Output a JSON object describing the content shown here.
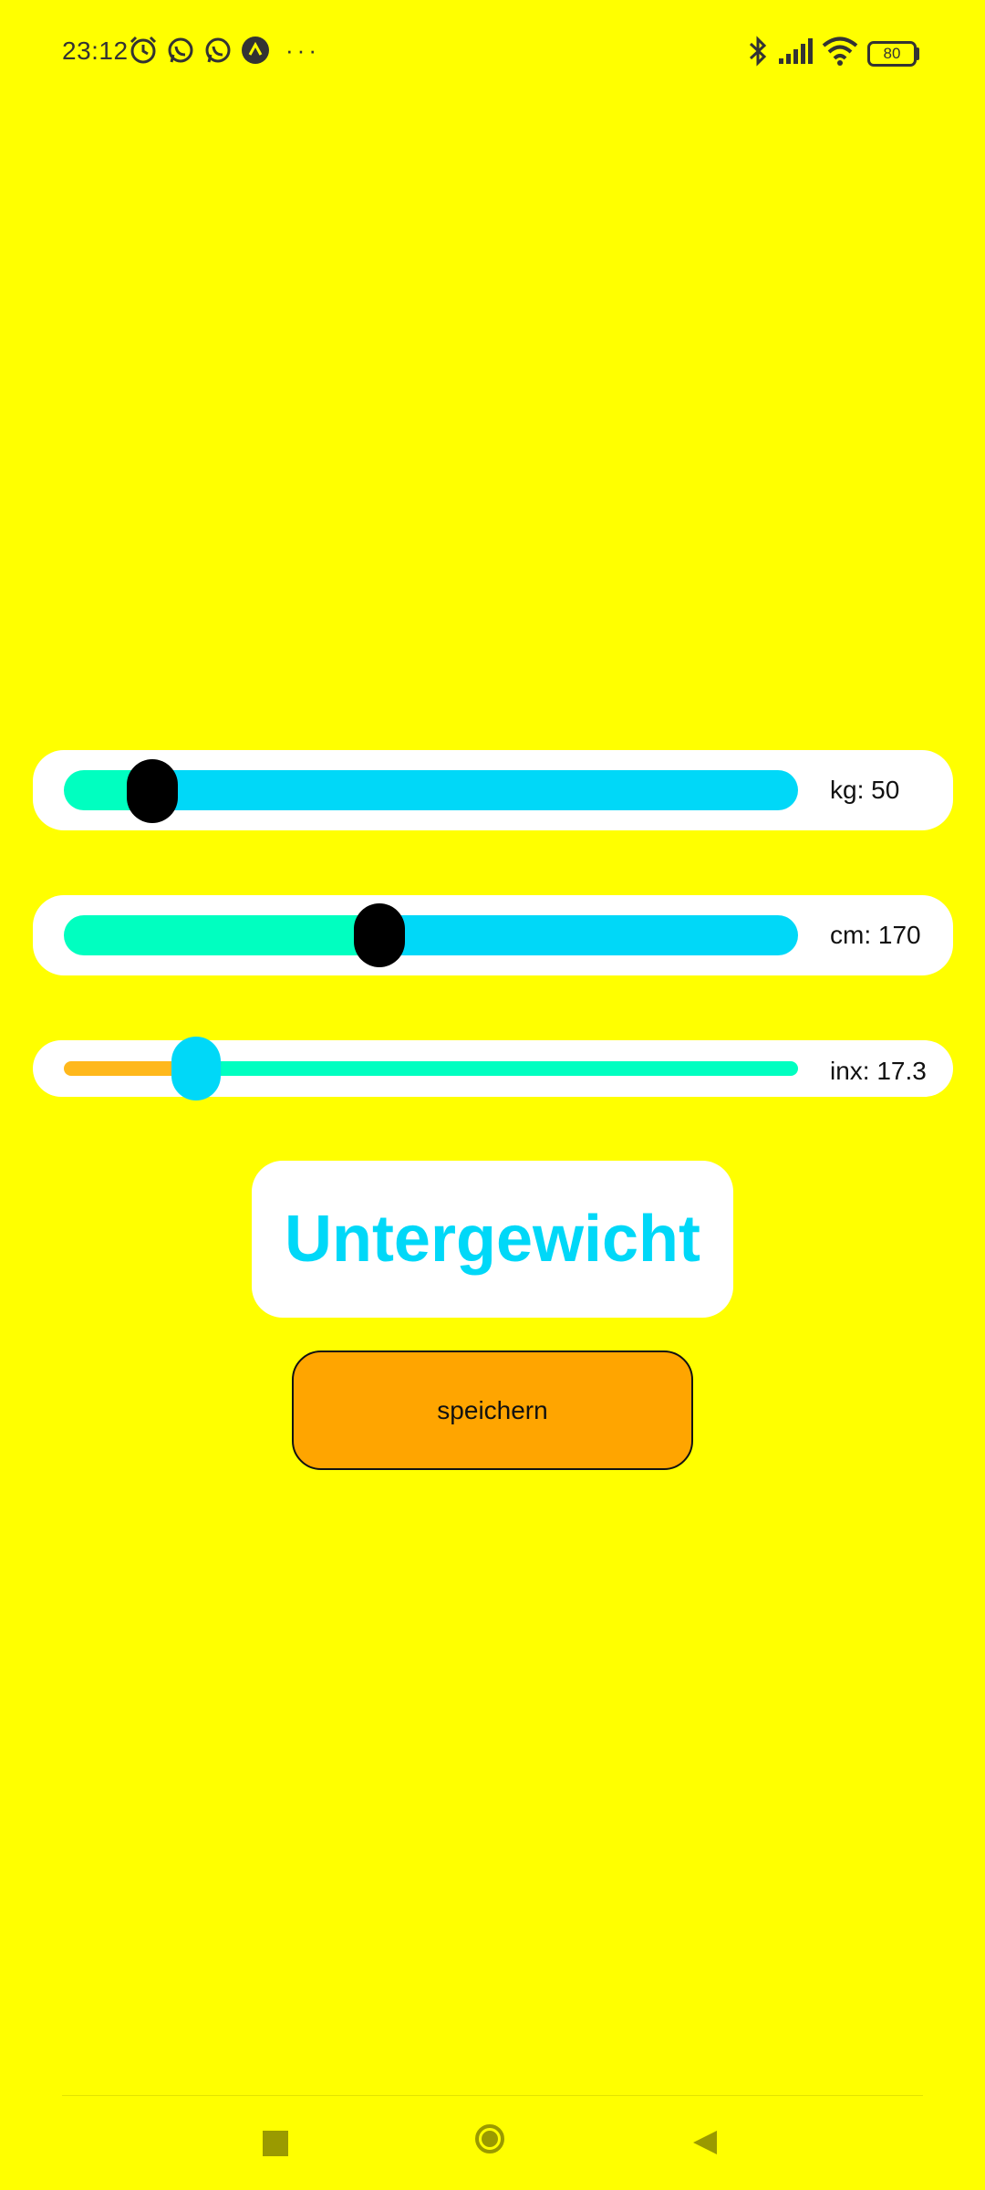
{
  "status_bar": {
    "time": "23:12",
    "battery": "80",
    "left_icons": [
      "alarm-icon",
      "whatsapp-icon",
      "whatsapp-icon",
      "app-notification-icon"
    ],
    "right_icons": [
      "bluetooth-icon",
      "signal-icon",
      "wifi-icon",
      "battery-icon"
    ],
    "overflow": "···"
  },
  "sliders": [
    {
      "name": "kg",
      "label": "kg: 50",
      "level": 0.12,
      "fill_color": "#00FFC0",
      "track_color": "#00D8F8",
      "thumb_color": "#000000"
    },
    {
      "name": "cm",
      "label": "cm: 170",
      "level": 0.43,
      "fill_color": "#00FFC0",
      "track_color": "#00D8F8",
      "thumb_color": "#000000"
    },
    {
      "name": "inx",
      "label": "inx: 17.3",
      "level": 0.18,
      "fill_color": "#FFB81C",
      "track_color": "#00FFC0",
      "thumb_color": "#00D8F8"
    }
  ],
  "result": {
    "text": "Untergewicht",
    "color": "#00D8F8"
  },
  "save_button": {
    "label": "speichern",
    "color": "#FFA500"
  },
  "background_color": "#FFFF00",
  "nav_bar": {
    "icons": [
      "recents-square-icon",
      "home-circle-icon",
      "back-triangle-icon"
    ]
  }
}
